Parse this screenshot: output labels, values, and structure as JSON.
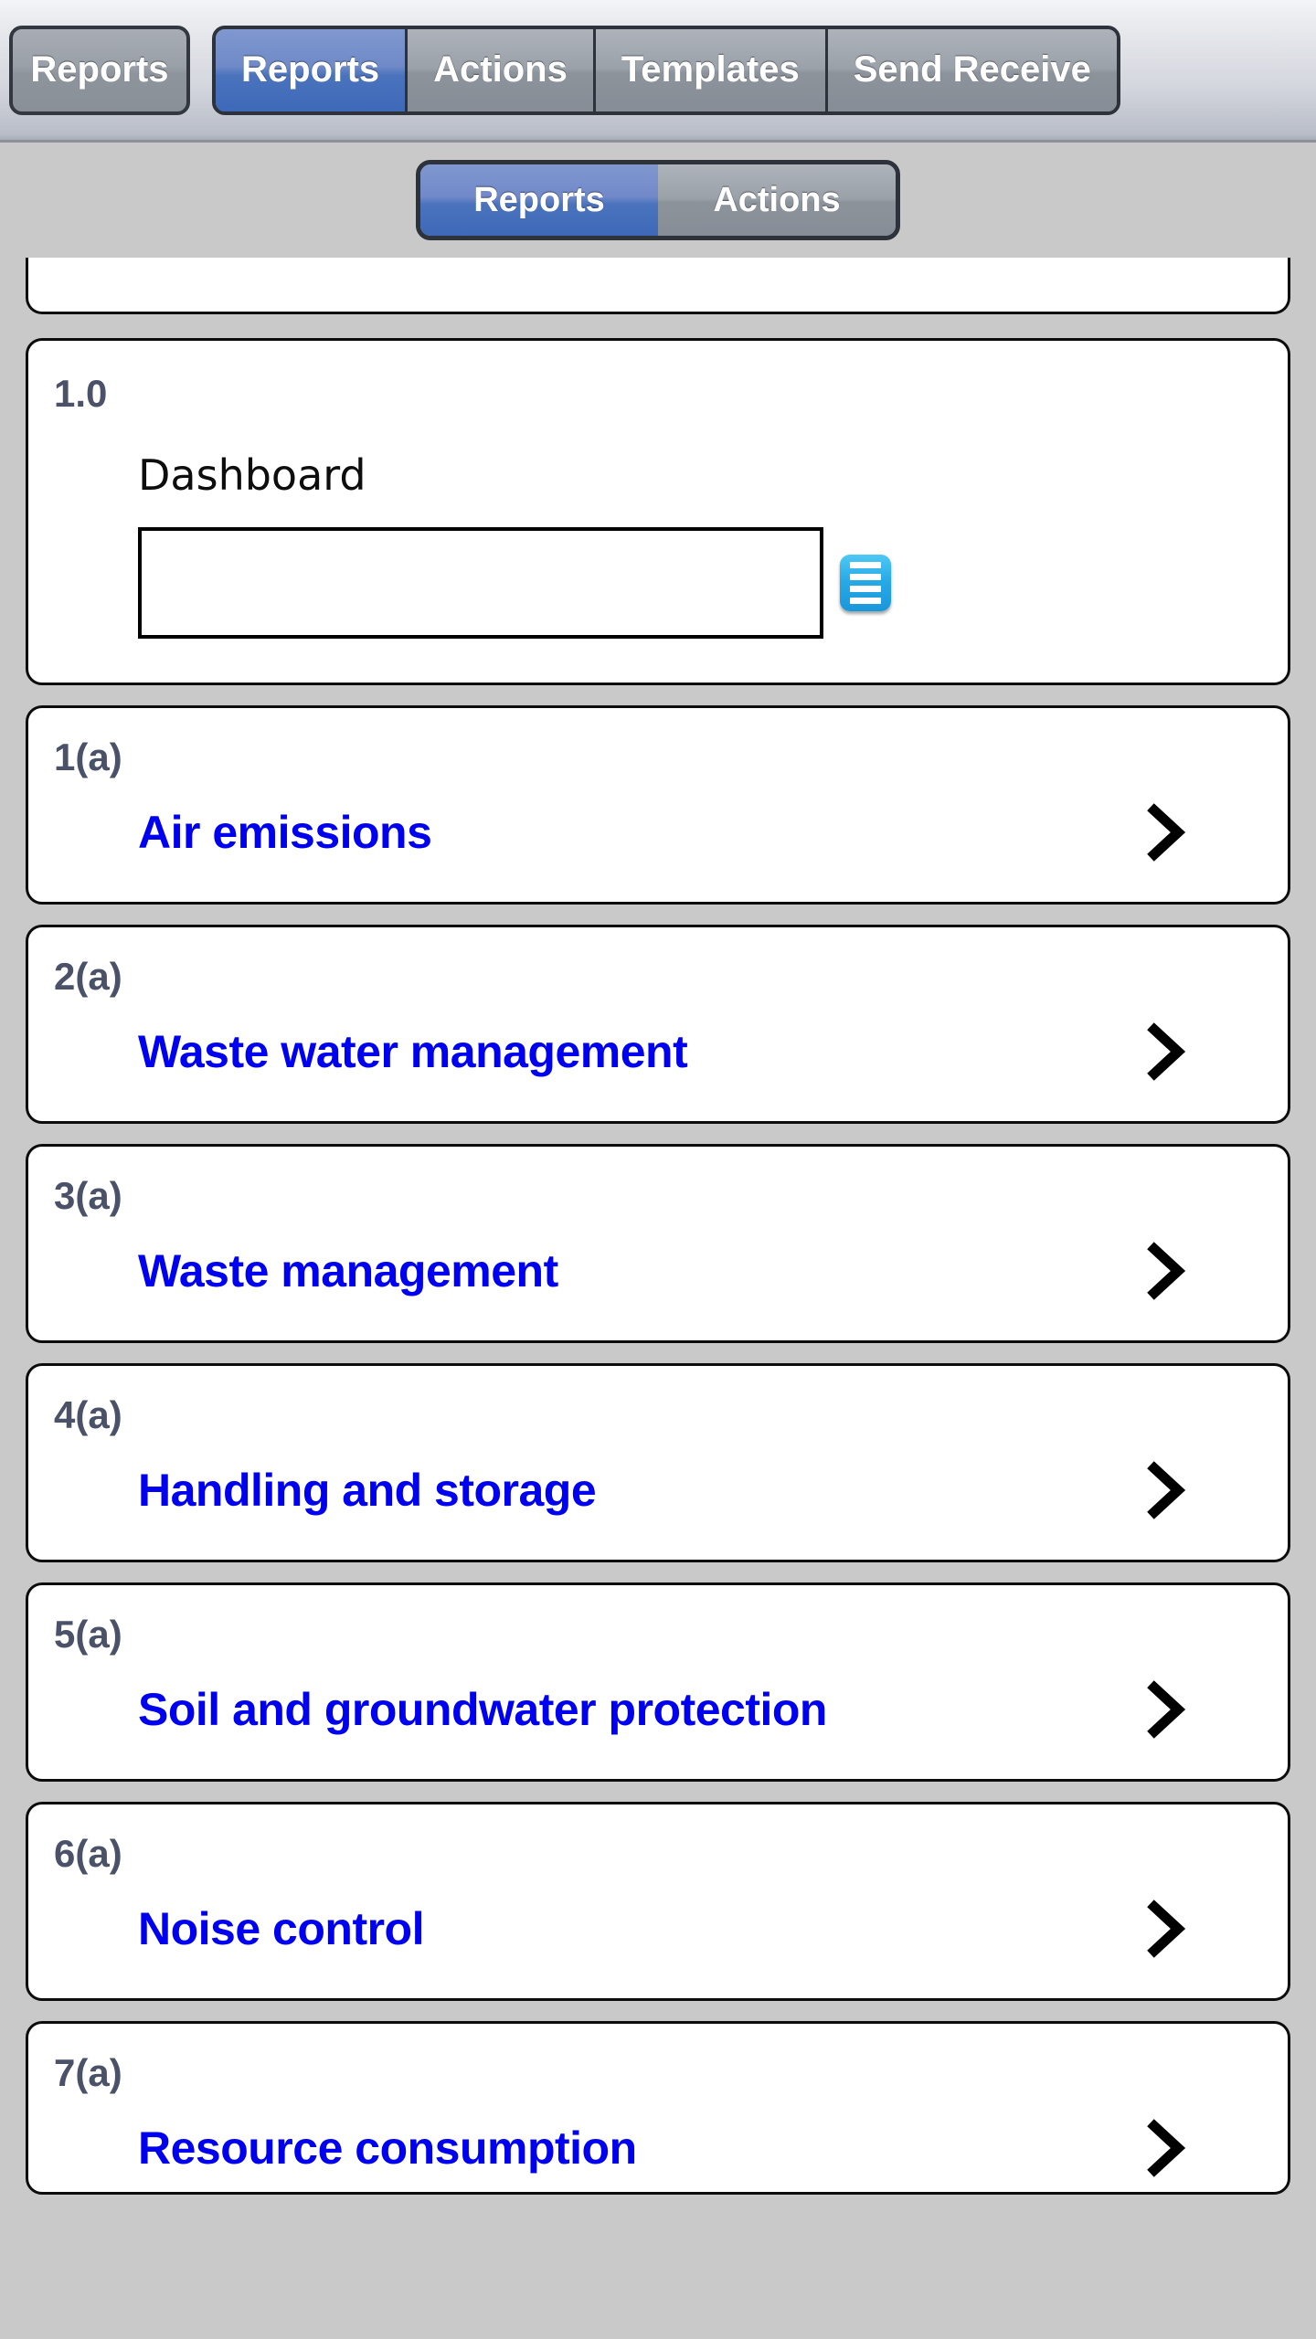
{
  "toolbar": {
    "back_button_label": "Reports",
    "segments": [
      {
        "label": "Reports",
        "active": true
      },
      {
        "label": "Actions",
        "active": false
      },
      {
        "label": "Templates",
        "active": false
      },
      {
        "label": "Send Receive",
        "active": false
      }
    ]
  },
  "subbar": {
    "segments": [
      {
        "label": "Reports",
        "active": true
      },
      {
        "label": "Actions",
        "active": false
      }
    ]
  },
  "content": {
    "dashboard_card": {
      "index": "1.0",
      "label": "Dashboard",
      "input_value": "",
      "input_placeholder": "",
      "picker_icon": "list-icon"
    },
    "rows": [
      {
        "index": "1(a)",
        "label": "Air emissions",
        "chevron": "chevron-right-icon"
      },
      {
        "index": "2(a)",
        "label": "Waste water management",
        "chevron": "chevron-right-icon"
      },
      {
        "index": "3(a)",
        "label": "Waste management",
        "chevron": "chevron-right-icon"
      },
      {
        "index": "4(a)",
        "label": "Handling and storage",
        "chevron": "chevron-right-icon"
      },
      {
        "index": "5(a)",
        "label": "Soil and groundwater protection",
        "chevron": "chevron-right-icon"
      },
      {
        "index": "6(a)",
        "label": "Noise control",
        "chevron": "chevron-right-icon"
      },
      {
        "index": "7(a)",
        "label": "Resource consumption",
        "chevron": "chevron-right-icon"
      }
    ]
  },
  "colors": {
    "accent_blue": "#3e69b8",
    "link_blue": "#0000f0",
    "index_slate": "#4a5168",
    "page_background": "#c9c9c9",
    "icon_blue": "#27a9e6"
  }
}
